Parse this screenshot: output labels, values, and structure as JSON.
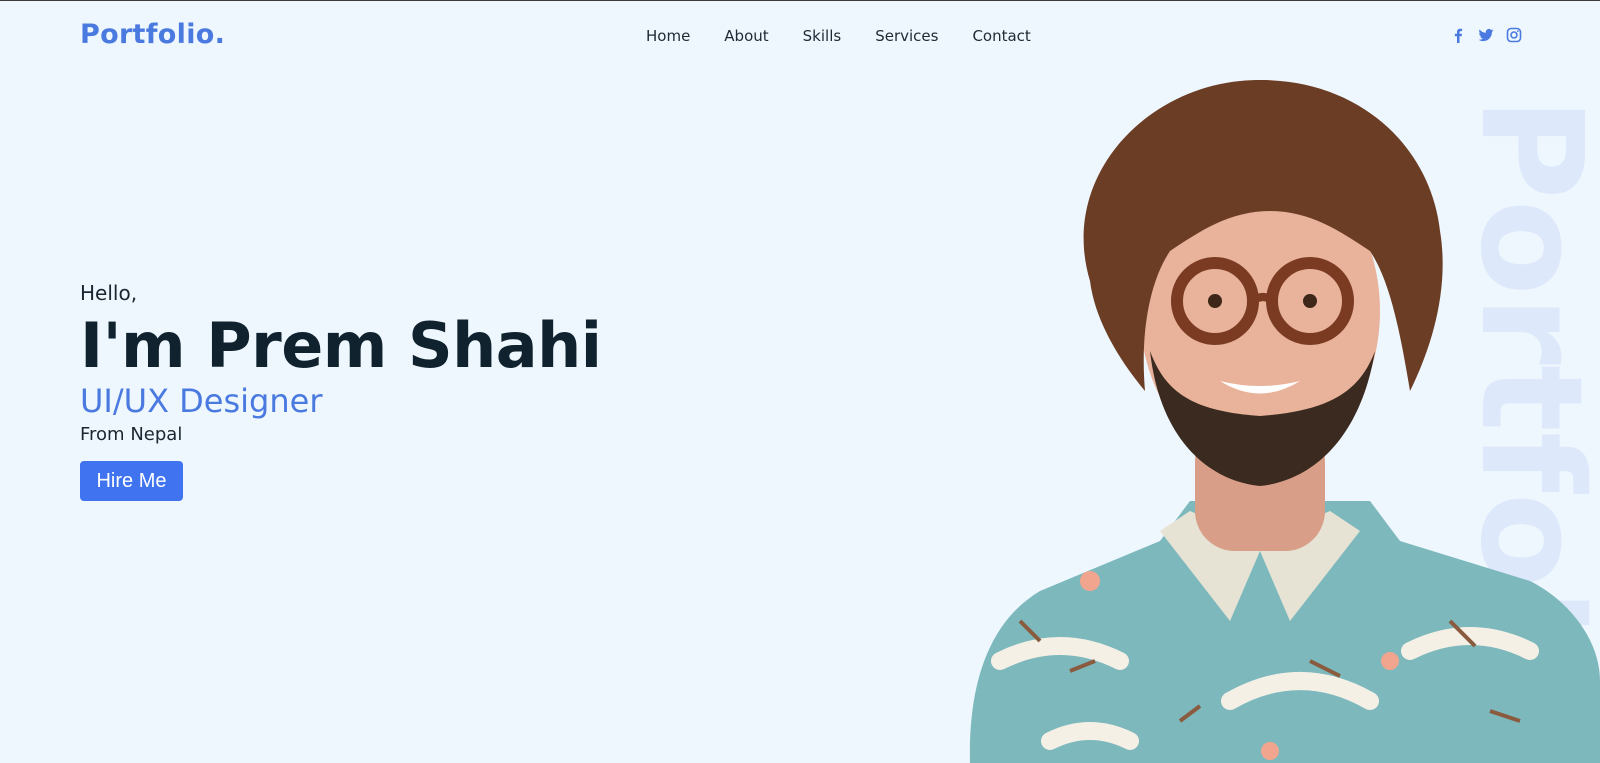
{
  "navbar": {
    "logo": "Portfolio.",
    "links": [
      "Home",
      "About",
      "Skills",
      "Services",
      "Contact"
    ],
    "socials": [
      "facebook-icon",
      "twitter-icon",
      "instagram-icon"
    ]
  },
  "hero": {
    "greeting": "Hello,",
    "name": "I'm Prem Shahi",
    "role": "UI/UX Designer",
    "origin": "From Nepal",
    "cta_label": "Hire Me",
    "watermark": "Portfolio"
  },
  "colors": {
    "accent": "#4a7ae0",
    "button": "#3f73ef",
    "background": "#eef7fe",
    "heading": "#10222e"
  }
}
